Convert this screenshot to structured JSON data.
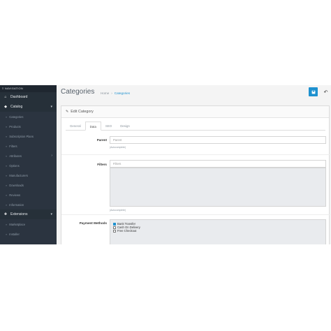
{
  "sidebar": {
    "header": "NAVIGATION",
    "items": [
      {
        "label": "Dashboard",
        "icon": "home-icon",
        "type": "section"
      },
      {
        "label": "Catalog",
        "icon": "tag-icon",
        "type": "section"
      },
      {
        "label": "Categories",
        "type": "sub"
      },
      {
        "label": "Products",
        "type": "sub"
      },
      {
        "label": "Subscription Plans",
        "type": "sub"
      },
      {
        "label": "Filters",
        "type": "sub"
      },
      {
        "label": "Attributes",
        "type": "sub"
      },
      {
        "label": "Options",
        "type": "sub"
      },
      {
        "label": "Manufacturers",
        "type": "sub"
      },
      {
        "label": "Downloads",
        "type": "sub"
      },
      {
        "label": "Reviews",
        "type": "sub"
      },
      {
        "label": "Information",
        "type": "sub"
      },
      {
        "label": "Extensions",
        "icon": "puzzle-icon",
        "type": "section"
      },
      {
        "label": "Marketplace",
        "type": "sub"
      },
      {
        "label": "Installer",
        "type": "sub"
      }
    ]
  },
  "header": {
    "title": "Categories",
    "breadcrumb": [
      "Home",
      "Categories"
    ]
  },
  "panel": {
    "title": "Edit Category",
    "tabs": [
      "General",
      "Data",
      "SEO",
      "Design"
    ],
    "active_tab": "Data"
  },
  "form": {
    "parent_label": "Parent",
    "parent_placeholder": "Parent",
    "parent_help": "(Autocomplete)",
    "filters_label": "Filters",
    "filters_placeholder": "Filters",
    "filters_help": "(Autocomplete)",
    "payment_label": "Payment Methods",
    "payment_methods": [
      {
        "label": "Bank Transfer",
        "checked": true
      },
      {
        "label": "Cash On Delivery",
        "checked": false
      },
      {
        "label": "Free Checkout",
        "checked": false
      }
    ]
  },
  "colors": {
    "sidebar_bg": "#2b3440",
    "accent": "#1e91cf"
  }
}
